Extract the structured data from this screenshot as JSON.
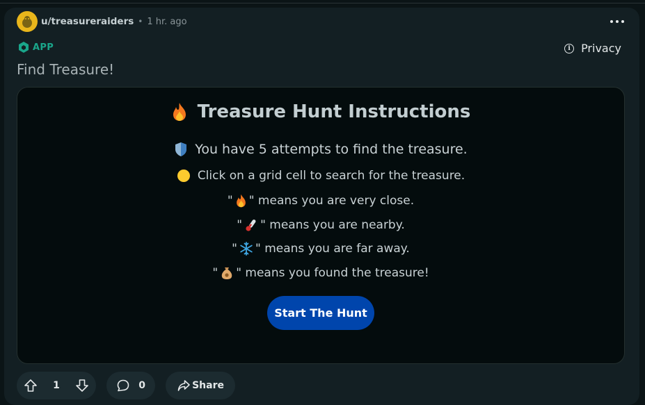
{
  "post": {
    "subreddit": "u/treasureraiders",
    "separator": "•",
    "time": "1 hr. ago",
    "app_label": "APP",
    "privacy_label": "Privacy",
    "title": "Find Treasure!"
  },
  "embed": {
    "title": "Treasure Hunt Instructions",
    "attempts_line": "You have 5 attempts to find the treasure.",
    "click_line": "Click on a grid cell to search for the treasure.",
    "hints": [
      {
        "icon": "fire-icon",
        "prefix": "\"",
        "suffix": "\" means you are very close."
      },
      {
        "icon": "thermometer-icon",
        "prefix": "\"",
        "suffix": "\" means you are nearby."
      },
      {
        "icon": "snowflake-icon",
        "prefix": "\"",
        "suffix": "\" means you are far away."
      },
      {
        "icon": "money-bag-icon",
        "prefix": "\"",
        "suffix": "\" means you found the treasure!"
      }
    ],
    "start_button": "Start The Hunt"
  },
  "actions": {
    "vote_count": "1",
    "comment_count": "0",
    "share_label": "Share"
  },
  "colors": {
    "background": "#0b1416",
    "card": "#131f23",
    "embed": "#040c0d",
    "accent_button": "#0045ac",
    "app_green": "#1aa58a"
  }
}
